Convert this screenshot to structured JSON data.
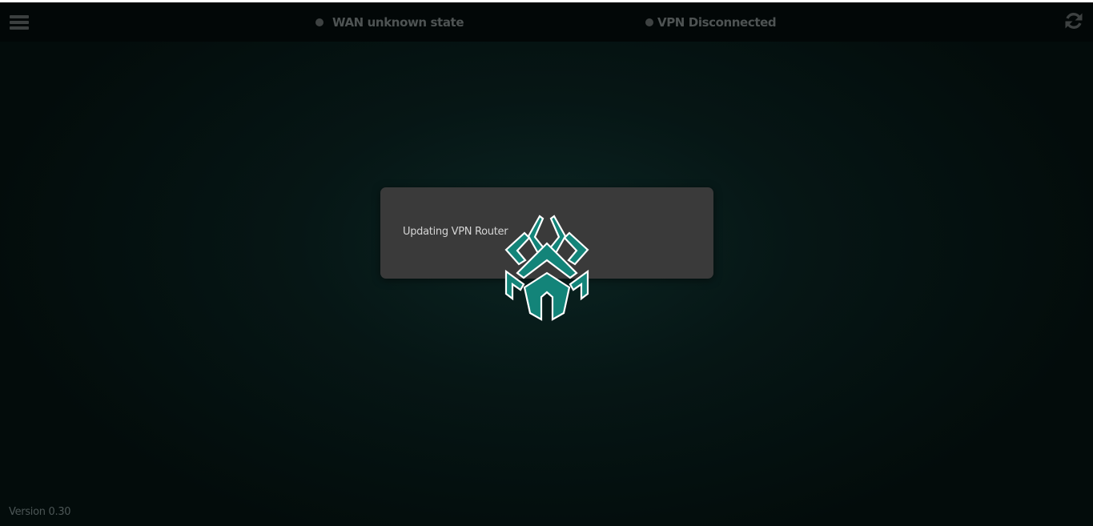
{
  "header": {
    "wan_status": "WAN unknown state",
    "vpn_status": "VPN Disconnected"
  },
  "icons": {
    "menu": "hamburger-menu-icon",
    "refresh": "refresh-icon",
    "logo": "spider-logo-icon",
    "status_dot": "status-dot-icon"
  },
  "dialog": {
    "message": "Updating VPN Router"
  },
  "footer": {
    "version": "Version 0.30"
  },
  "colors": {
    "background": "#061615",
    "topbar": "#020707",
    "dialog": "#3a3a3a",
    "logo_teal": "#138479",
    "status_inactive": "#3e4242"
  }
}
